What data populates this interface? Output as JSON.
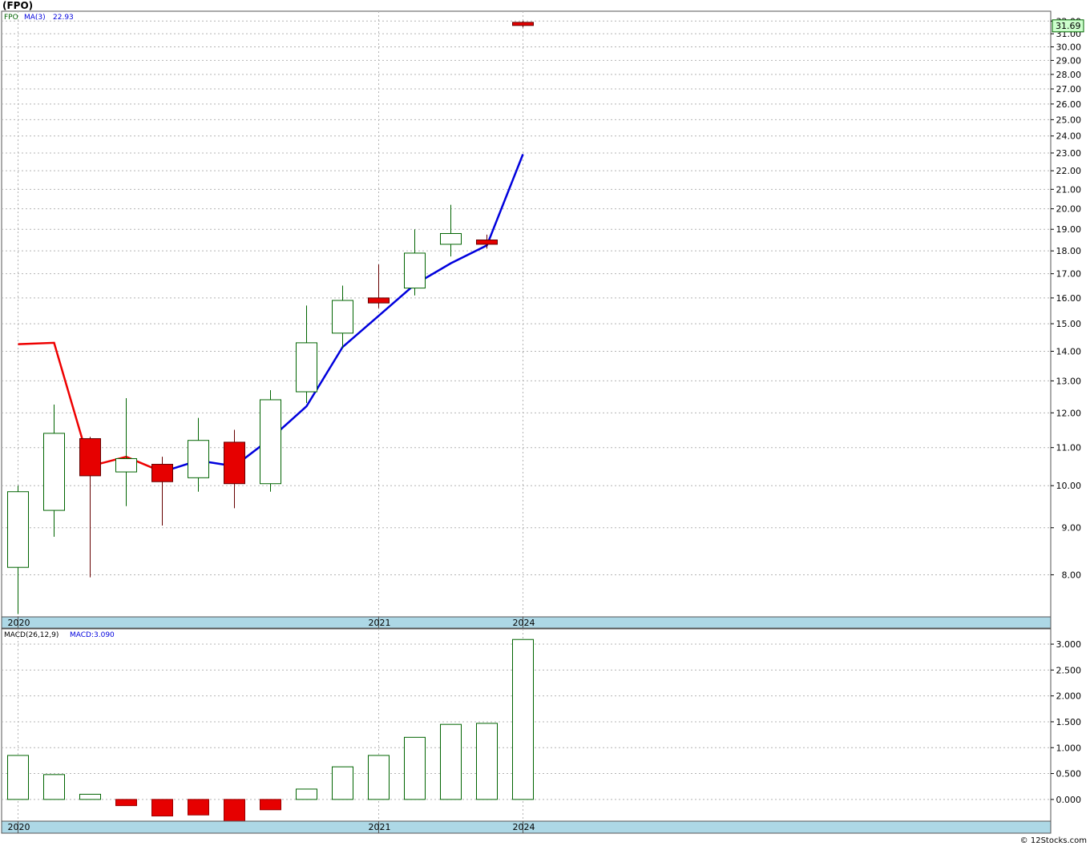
{
  "title": "(FPO)",
  "legend": {
    "symbol": "FPO",
    "ma_label": "MA(3)",
    "ma_value": "22.93",
    "macd_params": "MACD(26,12,9)",
    "macd_value": "MACD:3.090"
  },
  "last_price": "31.69",
  "credit": "© 12Stocks.com",
  "colors": {
    "up": "#006400",
    "down": "#e60000",
    "ma": "#0000dd",
    "ma_early": "#ee0000",
    "date_band": "#add8e6",
    "grid": "#b4b4b4",
    "price_box": "#ccffcc"
  },
  "chart_data": [
    {
      "type": "candlestick",
      "scale": "log",
      "ylim": [
        7.2,
        32.8
      ],
      "y_ticks": [
        "32.00",
        "31.00",
        "30.00",
        "29.00",
        "28.00",
        "27.00",
        "26.00",
        "25.00",
        "24.00",
        "23.00",
        "22.00",
        "21.00",
        "20.00",
        "19.00",
        "18.00",
        "17.00",
        "16.00",
        "15.00",
        "14.00",
        "13.00",
        "12.00",
        "11.00",
        "10.00",
        "9.00",
        "8.00"
      ],
      "x_labels": [
        {
          "label": "2020",
          "at": 0
        },
        {
          "label": "2021",
          "at": 10
        },
        {
          "label": "2024",
          "at": 14
        }
      ],
      "candles": [
        {
          "o": 8.15,
          "h": 10.0,
          "l": 7.25,
          "c": 9.85
        },
        {
          "o": 9.4,
          "h": 12.25,
          "l": 8.8,
          "c": 11.4
        },
        {
          "o": 11.25,
          "h": 11.3,
          "l": 7.95,
          "c": 10.25
        },
        {
          "o": 10.35,
          "h": 12.45,
          "l": 9.5,
          "c": 10.7
        },
        {
          "o": 10.55,
          "h": 10.75,
          "l": 9.05,
          "c": 10.1
        },
        {
          "o": 10.2,
          "h": 11.85,
          "l": 9.85,
          "c": 11.2
        },
        {
          "o": 11.15,
          "h": 11.5,
          "l": 9.45,
          "c": 10.05
        },
        {
          "o": 10.05,
          "h": 12.7,
          "l": 9.85,
          "c": 12.4
        },
        {
          "o": 12.65,
          "h": 15.7,
          "l": 12.3,
          "c": 14.3
        },
        {
          "o": 14.65,
          "h": 16.5,
          "l": 14.1,
          "c": 15.9
        },
        {
          "o": 16.0,
          "h": 17.4,
          "l": 15.6,
          "c": 15.8
        },
        {
          "o": 16.4,
          "h": 19.0,
          "l": 16.1,
          "c": 17.9
        },
        {
          "o": 18.3,
          "h": 20.2,
          "l": 17.75,
          "c": 18.8
        },
        {
          "o": 18.5,
          "h": 18.75,
          "l": 18.1,
          "c": 18.3
        },
        {
          "o": 31.9,
          "h": 32.0,
          "l": 31.5,
          "c": 31.65
        }
      ],
      "ma3": [
        14.25,
        14.3,
        10.5,
        10.75,
        10.35,
        10.65,
        10.5,
        11.25,
        12.2,
        14.15,
        15.3,
        16.55,
        17.45,
        18.25,
        22.93
      ],
      "ma3_early_points": 5
    },
    {
      "type": "bar",
      "title": "MACD(26,12,9)",
      "ylim": [
        -0.42,
        3.14
      ],
      "y_ticks": [
        "3.000",
        "2.500",
        "2.000",
        "1.500",
        "1.000",
        "0.500",
        "0.000"
      ],
      "values": [
        0.85,
        0.48,
        0.1,
        -0.12,
        -0.32,
        -0.3,
        -0.42,
        -0.2,
        0.2,
        0.63,
        0.85,
        1.2,
        1.45,
        1.47,
        3.09
      ],
      "x_labels": [
        {
          "label": "2020",
          "at": 0
        },
        {
          "label": "2021",
          "at": 10
        },
        {
          "label": "2024",
          "at": 14
        }
      ]
    }
  ]
}
